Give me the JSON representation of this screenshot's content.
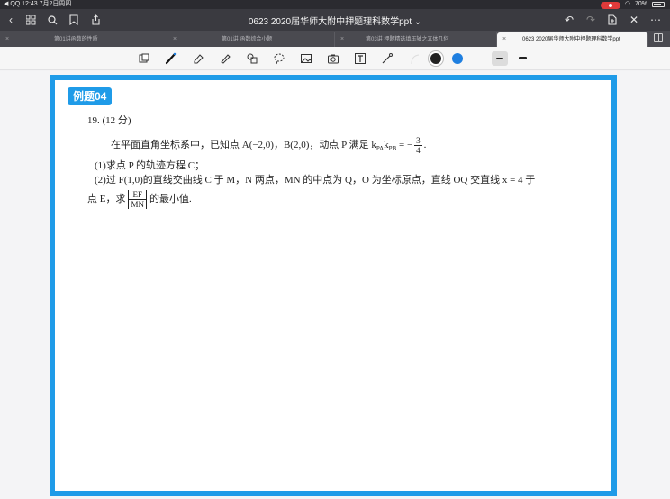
{
  "status": {
    "left": "◀ QQ  12:43  7月2日周四",
    "right": "70%"
  },
  "title": "0623 2020届华师大附中押题理科数学ppt ⌄",
  "tabs": [
    {
      "label": "第01讲函数的性质"
    },
    {
      "label": "第01讲 函数综合小题"
    },
    {
      "label": "第03讲 押题精选填压轴之立体几何"
    },
    {
      "label": "0623 2020届华师大附中押题理科数学ppt"
    }
  ],
  "toolbar": {
    "colors": [
      "#222222",
      "#1f7fe0"
    ],
    "icons": [
      "select-icon",
      "pen-icon",
      "eraser-icon",
      "highlighter-icon",
      "shapes-icon",
      "lasso-icon",
      "image-icon",
      "camera-icon",
      "text-icon",
      "laser-icon"
    ]
  },
  "slide": {
    "badge": "例题04",
    "problem_number": "19. (12 分)",
    "line1": "在平面直角坐标系中，已知点 A(−2,0)，B(2,0)，动点 P 满足 k",
    "line1_sub1": "PA",
    "line1_mid": "k",
    "line1_sub2": "PB",
    "line1_eq": " = −",
    "frac1_num": "3",
    "frac1_den": "4",
    "line1_end": ".",
    "line2": "(1)求点 P 的轨迹方程 C；",
    "line3": "(2)过 F(1,0)的直线交曲线 C 于 M，N 两点，MN 的中点为 Q，O 为坐标原点，直线 OQ 交直线 x = 4 于",
    "line4_start": "点 E，求",
    "frac2_num": "EF",
    "frac2_den": "MN",
    "line4_end": "的最小值."
  }
}
